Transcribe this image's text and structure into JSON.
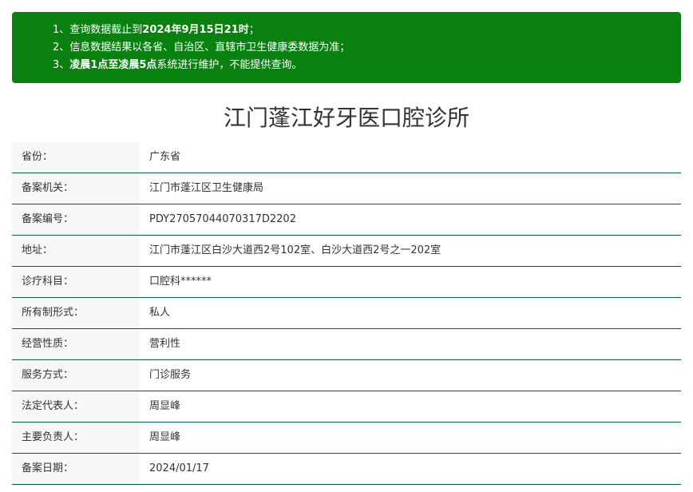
{
  "notice": {
    "line1_prefix": "1、查询数据截止到",
    "line1_bold": "2024年9月15日21时",
    "line1_suffix": "；",
    "line2": "2、信息数据结果以各省、自治区、直辖市卫生健康委数据为准；",
    "line3_prefix": "3、",
    "line3_bold": "凌晨1点至凌晨5点",
    "line3_suffix": "系统进行维护，不能提供查询。"
  },
  "title": "江门蓬江好牙医口腔诊所",
  "colors": {
    "notice_bg": "#0a8010",
    "row_divider": "#0b5e3c",
    "label_bg": "#f7f7f7"
  },
  "rows": [
    {
      "label": "省份：",
      "value": "广东省"
    },
    {
      "label": "备案机关：",
      "value": "江门市蓬江区卫生健康局"
    },
    {
      "label": "备案编号：",
      "value": "PDY27057044070317D2202"
    },
    {
      "label": "地址：",
      "value": "江门市蓬江区白沙大道西2号102室、白沙大道西2号之一202室"
    },
    {
      "label": "诊疗科目：",
      "value": "口腔科******"
    },
    {
      "label": "所有制形式：",
      "value": "私人"
    },
    {
      "label": "经营性质：",
      "value": "营利性"
    },
    {
      "label": "服务方式：",
      "value": "门诊服务"
    },
    {
      "label": "法定代表人：",
      "value": "周显峰"
    },
    {
      "label": "主要负责人：",
      "value": "周显峰"
    },
    {
      "label": "备案日期：",
      "value": "2024/01/17"
    }
  ]
}
